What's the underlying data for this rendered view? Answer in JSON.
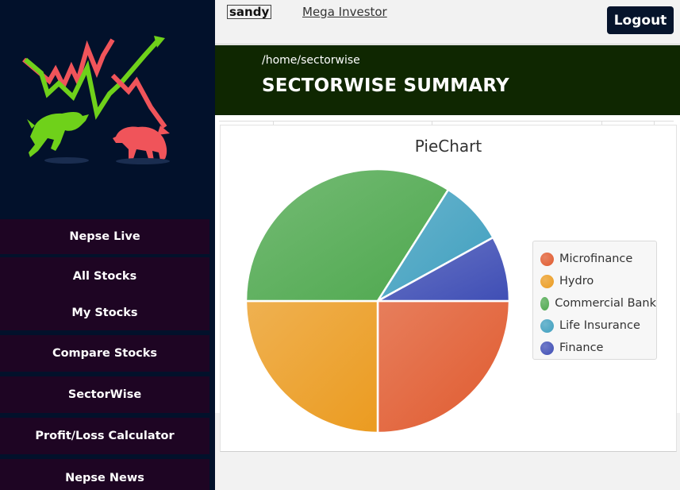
{
  "user": {
    "name": "sandy",
    "role": "Mega Investor"
  },
  "header": {
    "logout_label": "Logout"
  },
  "banner": {
    "breadcrumb": "/home/sectorwise",
    "title": "SECTORWISE SUMMARY"
  },
  "sidebar": {
    "items": [
      {
        "label": "Nepse Live"
      },
      {
        "label": "All Stocks"
      },
      {
        "label": "My Stocks"
      },
      {
        "label": "Compare Stocks"
      },
      {
        "label": "SectorWise"
      },
      {
        "label": "Profit/Loss Calculator"
      },
      {
        "label": "Nepse News"
      }
    ]
  },
  "colors": {
    "sidebar_bg": "#02112b",
    "nav_item_bg": "#1e0523",
    "banner_bg": "#0f2701",
    "logout_bg": "#06142c",
    "bull": "#6fd11a",
    "bear": "#f0545a"
  },
  "chart_data": {
    "type": "pie",
    "title": "PieChart",
    "legend": "right",
    "start": "3 o'clock, clockwise",
    "categories": [
      "Microfinance",
      "Hydro",
      "Commercial Bank",
      "Life Insurance",
      "Finance"
    ],
    "values": [
      25,
      25,
      34,
      8,
      8
    ],
    "colors": [
      "#e05a2e",
      "#eb9b20",
      "#4ea84e",
      "#3f9fbf",
      "#3f4eb5"
    ]
  }
}
